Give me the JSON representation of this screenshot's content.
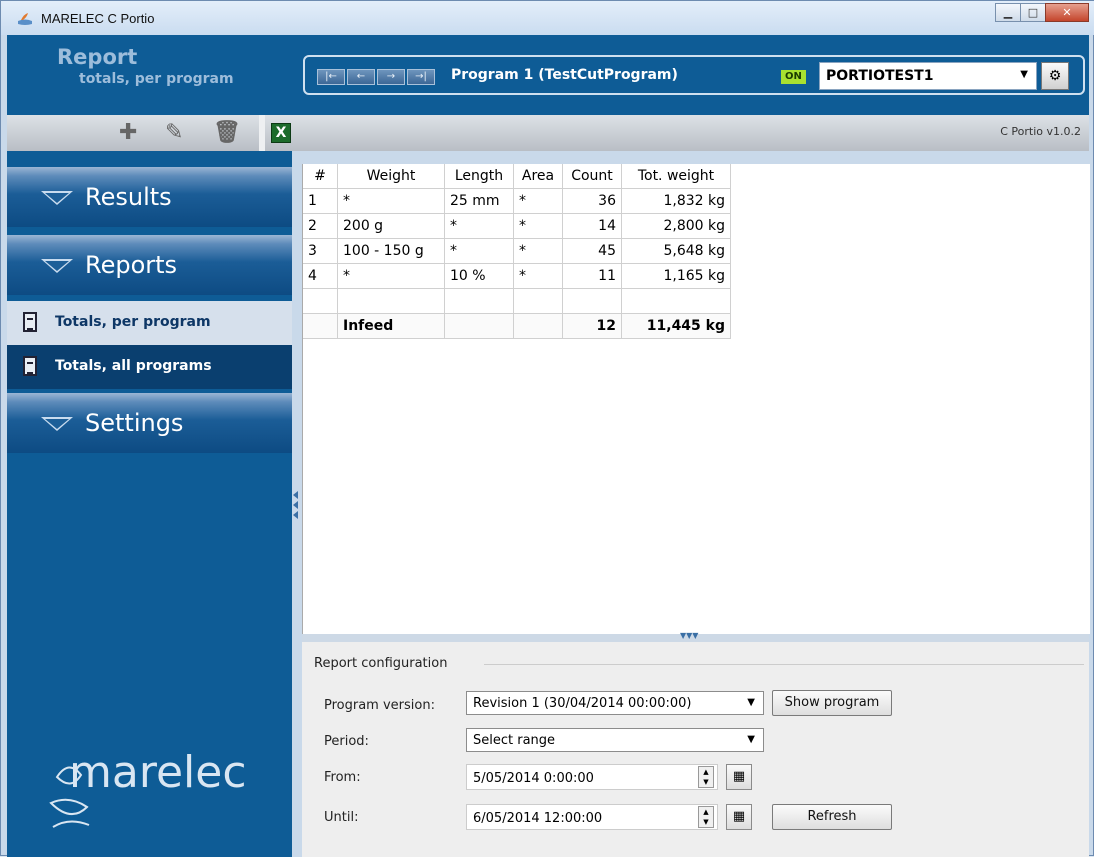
{
  "window": {
    "title": "MARELEC C Portio"
  },
  "header": {
    "title": "Report",
    "subtitle": "totals, per program",
    "program_name": "Program 1 (TestCutProgram)",
    "on_badge": "ON",
    "selected_device": "PORTIOTEST1"
  },
  "toolbar": {
    "version": "C Portio v1.0.2"
  },
  "sidebar": {
    "sections": [
      "Results",
      "Reports",
      "Settings"
    ],
    "report_items": [
      "Totals, per program",
      "Totals, all programs"
    ],
    "logo": "marelec"
  },
  "grid": {
    "columns": [
      "#",
      "Weight",
      "Length",
      "Area",
      "Count",
      "Tot. weight"
    ],
    "rows": [
      [
        "1",
        "*",
        "25 mm",
        "*",
        "36",
        "1,832 kg"
      ],
      [
        "2",
        "200 g",
        "*",
        "*",
        "14",
        "2,800 kg"
      ],
      [
        "3",
        "100 - 150 g",
        "*",
        "*",
        "45",
        "5,648 kg"
      ],
      [
        "4",
        "*",
        "10 %",
        "*",
        "11",
        "1,165 kg"
      ]
    ],
    "total": [
      "",
      "Infeed",
      "",
      "",
      "12",
      "11,445 kg"
    ]
  },
  "config": {
    "title": "Report configuration",
    "program_version_label": "Program version:",
    "program_version_value": "Revision 1 (30/04/2014 00:00:00)",
    "show_program_label": "Show program",
    "period_label": "Period:",
    "period_value": "Select range",
    "from_label": "From:",
    "from_value": "5/05/2014 0:00:00",
    "until_label": "Until:",
    "until_value": "6/05/2014 12:00:00",
    "refresh_label": "Refresh"
  }
}
